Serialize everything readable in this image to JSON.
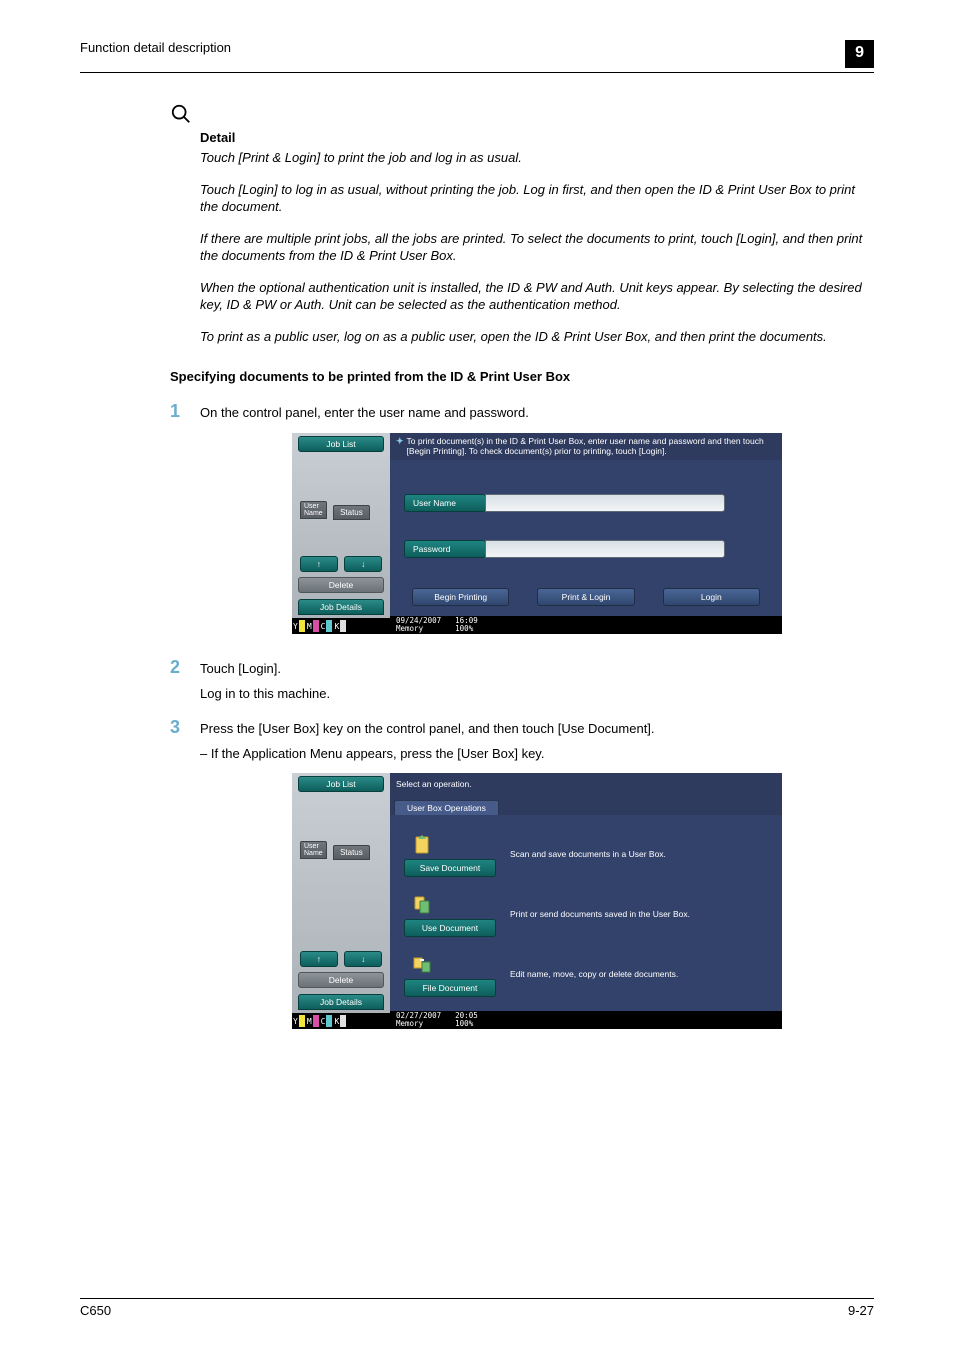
{
  "header": {
    "title": "Function detail description",
    "chapter": "9"
  },
  "detail": {
    "heading": "Detail",
    "p1": "Touch [Print & Login] to print the job and log in as usual.",
    "p2": "Touch [Login] to log in as usual, without printing the job. Log in first, and then open the ID & Print User Box to print the document.",
    "p3": "If there are multiple print jobs, all the jobs are printed. To select the documents to print, touch [Login], and then print the documents from the ID & Print User Box.",
    "p4": "When the optional authentication unit is installed, the ID & PW and Auth. Unit keys appear. By selecting the desired key, ID & PW or Auth. Unit can be selected as the authentication method.",
    "p5": "To print as a public user, log on as a public user, open the ID & Print User Box, and then print the documents."
  },
  "section_heading": "Specifying documents to be printed from the ID & Print User Box",
  "steps": {
    "s1": {
      "num": "1",
      "text": "On the control panel, enter the user name and password."
    },
    "s2": {
      "num": "2",
      "text": "Touch [Login].",
      "sub": "Log in to this machine."
    },
    "s3": {
      "num": "3",
      "text": "Press the [User Box] key on the control panel, and then touch [Use Document].",
      "bullet": "If the Application Menu appears, press the [User Box] key."
    }
  },
  "panel_common": {
    "job_list": "Job List",
    "user_name_tab": "User\nName",
    "status_tab": "Status",
    "delete": "Delete",
    "job_details": "Job Details",
    "up": "↑",
    "down": "↓",
    "memory_label": "Memory",
    "memory_value": "100%",
    "toners": [
      "Y",
      "M",
      "C",
      "K"
    ]
  },
  "panel1": {
    "message": "To print document(s) in the ID & Print User Box, enter user name and password and then touch [Begin Printing]. To check document(s) prior to printing, touch [Login].",
    "user_name_label": "User Name",
    "password_label": "Password",
    "begin_printing": "Begin Printing",
    "print_login": "Print & Login",
    "login": "Login",
    "date": "09/24/2007",
    "time": "16:09"
  },
  "panel2": {
    "message": "Select an operation.",
    "tab": "User Box Operations",
    "ops": {
      "save": {
        "label": "Save Document",
        "desc": "Scan and save documents in a User Box."
      },
      "use": {
        "label": "Use Document",
        "desc": "Print or send documents saved in the User Box."
      },
      "file": {
        "label": "File Document",
        "desc": "Edit name, move, copy or delete documents."
      }
    },
    "date": "02/27/2007",
    "time": "20:05"
  },
  "footer": {
    "left": "C650",
    "right": "9-27"
  }
}
